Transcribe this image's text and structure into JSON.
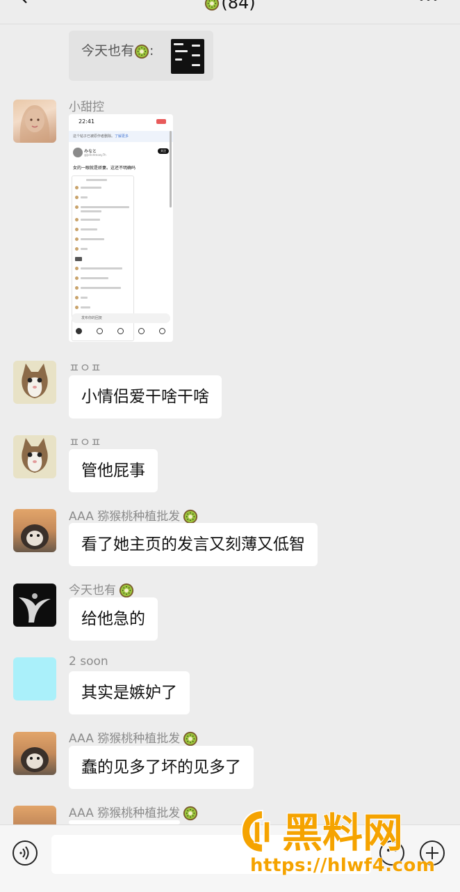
{
  "header": {
    "title": "(84)",
    "title_icon": "kiwi-icon"
  },
  "top_partial": {
    "text": "今天也有",
    "colon": ":"
  },
  "messages": [
    {
      "sender": "小甜控",
      "type": "image",
      "has_kiwi": false,
      "screenshot": {
        "time": "22:41",
        "notice": "这个帖子已被原作者删除。",
        "notice_link": "了解更多",
        "profile_name": "みなと",
        "profile_handle": "@JohnAmoey7h",
        "follow_label": "关注",
        "post_text": "女的一眼就是娇妻。这还不明确吗",
        "reply_placeholder": "发布你的回复"
      }
    },
    {
      "sender": "ㅍㅇㅍ",
      "text": "小情侣爱干啥干啥"
    },
    {
      "sender": "ㅍㅇㅍ",
      "text": "管他屁事"
    },
    {
      "sender": "AAA 猕猴桃种植批发",
      "text": "看了她主页的发言又刻薄又低智"
    },
    {
      "sender": "今天也有",
      "text": "给他急的"
    },
    {
      "sender": "2 soon",
      "text": "其实是嫉妒了"
    },
    {
      "sender": "AAA 猕猴桃种植批发",
      "text": "蠢的见多了坏的见多了"
    },
    {
      "sender": "AAA 猕猴桃种植批发",
      "text": ""
    }
  ],
  "input": {
    "placeholder": ""
  },
  "watermark": {
    "brand": "黑料网",
    "url": "https://hlwf4.com"
  },
  "colors": {
    "background": "#ededed",
    "bubble": "#ffffff",
    "sender": "#8b8b8b",
    "watermark": "#f5a300"
  }
}
